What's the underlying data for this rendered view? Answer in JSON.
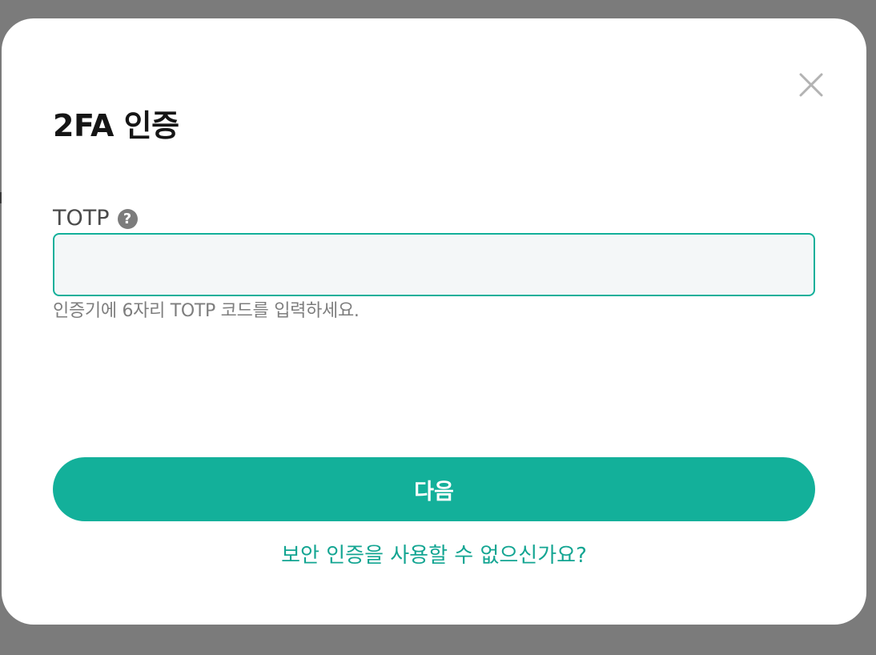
{
  "dialog": {
    "title": "2FA 인증",
    "close_icon": "close-icon",
    "field": {
      "label": "TOTP",
      "help_icon": "question-circle-icon",
      "help_glyph": "?",
      "value": "",
      "placeholder": "",
      "hint": "인증기에 6자리 TOTP 코드를 입력하세요."
    },
    "primary_button": {
      "label": "다음"
    },
    "secondary_link": {
      "label": "보안 인증을 사용할 수 없으신가요?"
    }
  },
  "colors": {
    "accent": "#13b09a",
    "link": "#13a592",
    "overlay": "#7b7b7b",
    "input_background": "#f4f7f8",
    "title_text": "#151515",
    "hint_text": "#7e7e7e"
  }
}
